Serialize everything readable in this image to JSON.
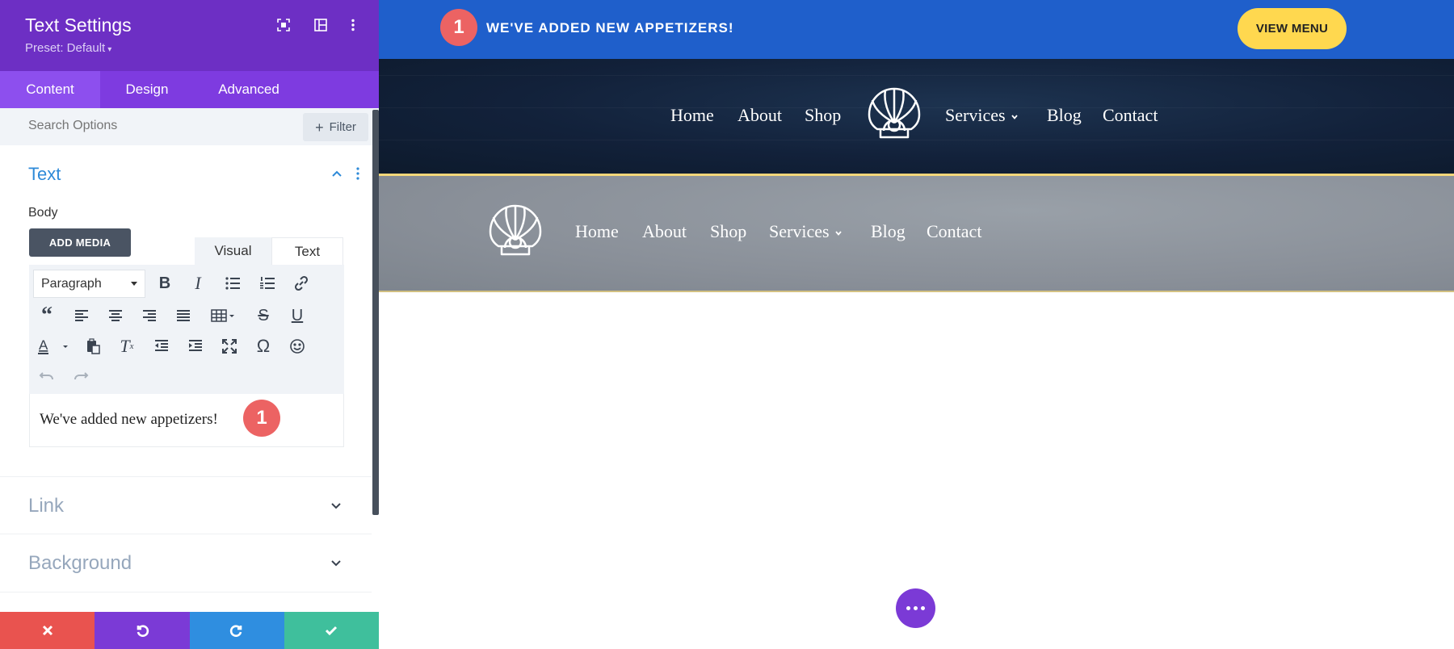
{
  "panel": {
    "title": "Text Settings",
    "preset": "Preset: Default",
    "tabs": [
      "Content",
      "Design",
      "Advanced"
    ],
    "search_placeholder": "Search Options",
    "filter_label": "Filter",
    "section_title": "Text",
    "body_label": "Body",
    "add_media_label": "ADD MEDIA",
    "editor_tabs": [
      "Visual",
      "Text"
    ],
    "format_select": "Paragraph",
    "editor_text": "We've added new appetizers!",
    "badge_number": "1",
    "collapsed_sections": [
      "Link",
      "Background"
    ],
    "colors": {
      "header": "#6d2fc4",
      "cancel": "#e9534f",
      "undo": "#7b3ad6",
      "redo": "#2f8ee0",
      "save": "#3fbf9c"
    }
  },
  "preview": {
    "topbar_badge": "1",
    "topbar_text": "WE'VE ADDED NEW APPETIZERS!",
    "view_menu_label": "VIEW MENU",
    "nav_primary": [
      "Home",
      "About",
      "Shop",
      "Services",
      "Blog",
      "Contact"
    ],
    "nav_secondary": [
      "Home",
      "About",
      "Shop",
      "Services",
      "Blog",
      "Contact"
    ],
    "colors": {
      "topbar": "#1f5fcb",
      "button": "#ffd84f",
      "badge": "#ec6363"
    }
  }
}
